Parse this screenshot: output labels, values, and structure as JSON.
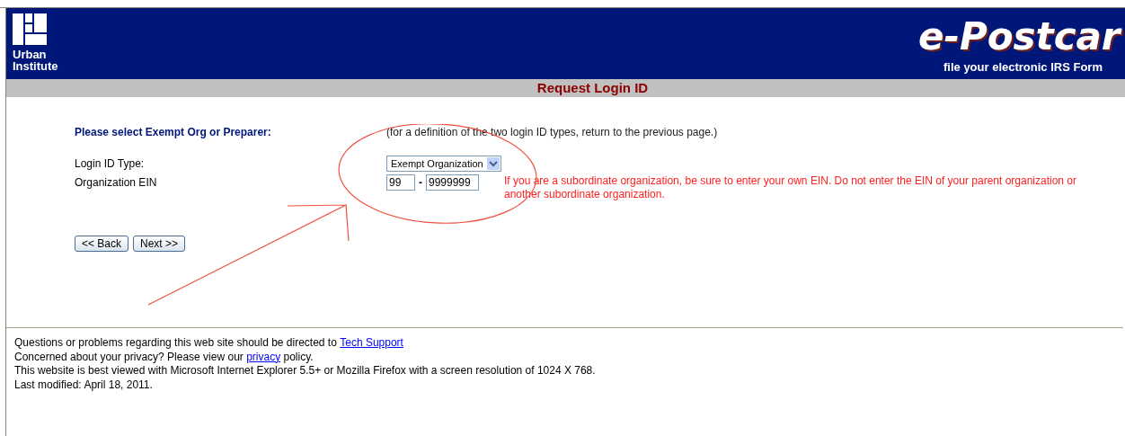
{
  "header": {
    "org_name": "Urban Institute",
    "brand": "e-Postcar",
    "tagline": "file your electronic IRS Form"
  },
  "page_title": "Request Login ID",
  "form": {
    "heading": "Please select Exempt Org or Preparer:",
    "note": "(for a definition of the two login ID types, return to the previous page.)",
    "login_type": {
      "label": "Login ID Type:",
      "value": "Exempt Organization"
    },
    "ein": {
      "label": "Organization EIN",
      "prefix": "99",
      "separator": "-",
      "suffix": "9999999",
      "warning": "If you are a subordinate organization, be sure to enter your own EIN. Do not enter the EIN of your parent organization or another subordinate organization."
    },
    "buttons": [
      "<< Back",
      "Next >>"
    ]
  },
  "footer": [
    {
      "before": "Questions or problems regarding this web site should be directed to ",
      "link": "Tech Support"
    },
    {
      "before": "Concerned about your privacy? Please view our ",
      "link": "privacy",
      "after": " policy."
    },
    {
      "before": "This website is best viewed with Microsoft Internet Explorer 5.5+ or Mozilla Firefox with a screen resolution of 1024 X 768."
    },
    {
      "before": "Last modified: April 18, 2011."
    }
  ]
}
